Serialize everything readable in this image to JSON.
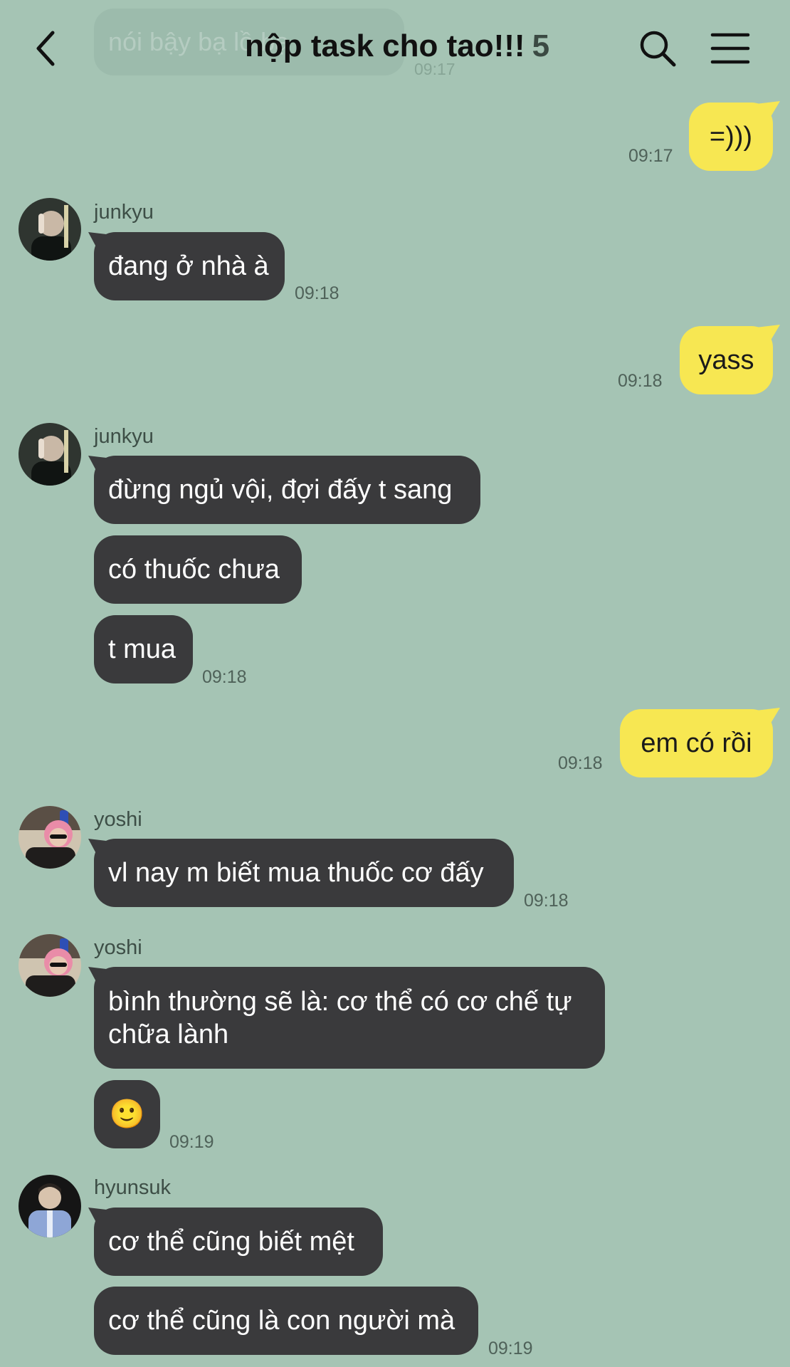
{
  "header": {
    "ghost_text": "nói bậy bạ lồ bạ",
    "ghost_time": "09:17",
    "title": "nộp task cho tao!!!",
    "member_count": "5"
  },
  "messages": {
    "m1": {
      "text": "=)))",
      "time": "09:17"
    },
    "m2": {
      "sender": "junkyu",
      "text": "đang ở nhà à",
      "time": "09:18"
    },
    "m3": {
      "text": "yass",
      "time": "09:18"
    },
    "m4": {
      "sender": "junkyu",
      "lines": [
        "đừng ngủ vội, đợi đấy t sang",
        "có thuốc chưa",
        "t mua"
      ],
      "time": "09:18"
    },
    "m5": {
      "text": "em có rồi",
      "time": "09:18"
    },
    "m6": {
      "sender": "yoshi",
      "text": "vl nay m biết mua thuốc cơ đấy",
      "time": "09:18"
    },
    "m7": {
      "sender": "yoshi",
      "text": "bình thường sẽ là: cơ thể có cơ chế tự chữa lành",
      "emoji": "🙂",
      "time": "09:19"
    },
    "m8": {
      "sender": "hyunsuk",
      "lines": [
        "cơ thể cũng biết mệt",
        "cơ thể cũng là con người mà"
      ],
      "time": "09:19"
    }
  },
  "icons": {
    "back": "chevron-left-icon",
    "search": "search-icon",
    "menu": "hamburger-menu-icon"
  },
  "colors": {
    "background": "#a5c4b4",
    "incoming_bubble": "#3a3a3c",
    "outgoing_bubble": "#f7e752"
  }
}
